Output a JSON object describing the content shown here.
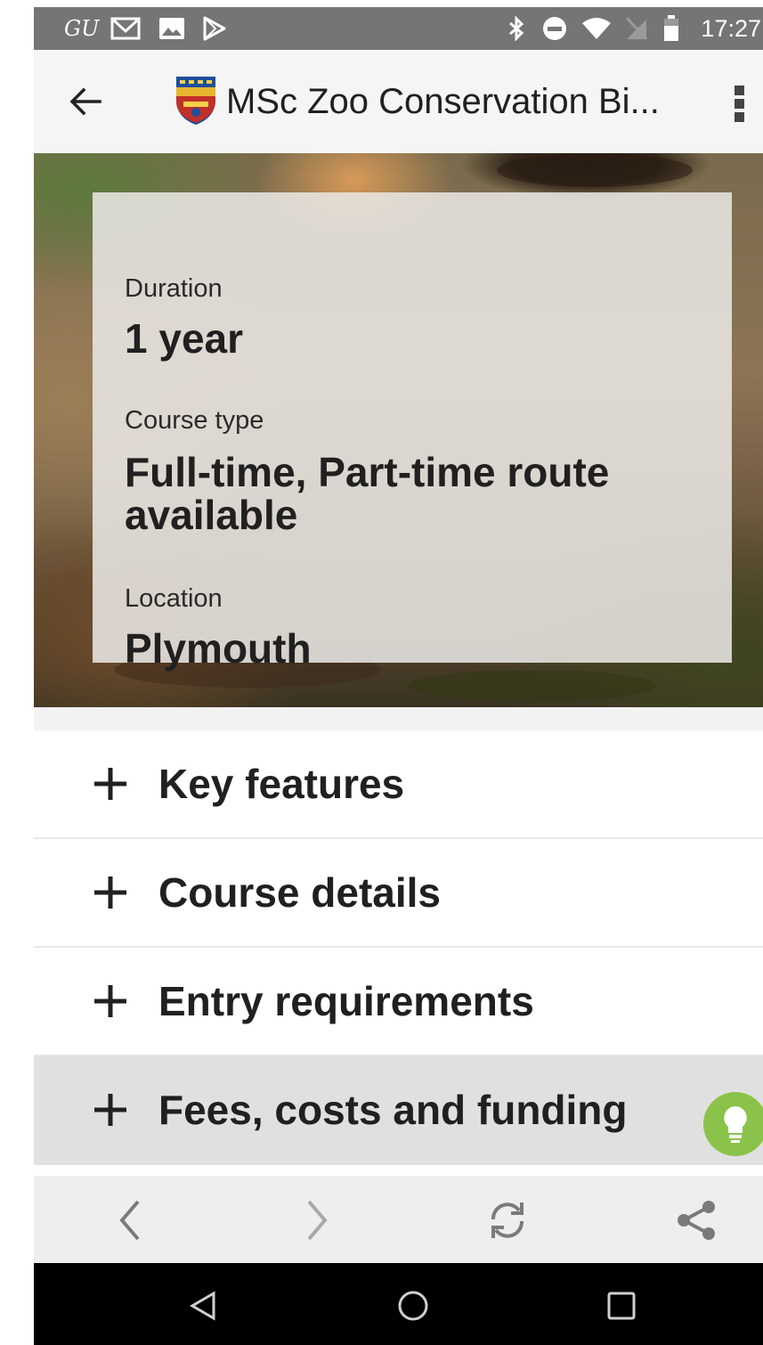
{
  "status_bar": {
    "carrier_glyph": "GU",
    "time": "17:27",
    "icons": [
      "gmail-icon",
      "image-icon",
      "play-store-icon",
      "bluetooth-icon",
      "do-not-disturb-icon",
      "wifi-icon",
      "no-sim-icon",
      "battery-icon"
    ]
  },
  "app_bar": {
    "title": "MSc Zoo Conservation Bi...",
    "icons": [
      "back-arrow-icon",
      "university-crest-icon",
      "overflow-menu-icon"
    ]
  },
  "hero": {
    "duration_label": "Duration",
    "duration_value": "1 year",
    "course_type_label": "Course type",
    "course_type_value": "Full-time, Part-time route available",
    "location_label": "Location",
    "location_value": "Plymouth"
  },
  "accordion": {
    "items": [
      {
        "label": "Key features"
      },
      {
        "label": "Course details"
      },
      {
        "label": "Entry requirements"
      },
      {
        "label": "Fees, costs and funding"
      }
    ]
  },
  "browser_bar": {
    "icons": [
      "back-chevron-icon",
      "forward-chevron-icon",
      "refresh-icon",
      "share-icon"
    ]
  },
  "nav_bar": {
    "icons": [
      "nav-back-icon",
      "nav-home-icon",
      "nav-recents-icon"
    ]
  },
  "colors": {
    "status_bar": "#757575",
    "app_bar": "#f5f5f5",
    "active_row": "#e0e0e0",
    "bulb": "#8bc34a",
    "nav_bar": "#000000"
  }
}
